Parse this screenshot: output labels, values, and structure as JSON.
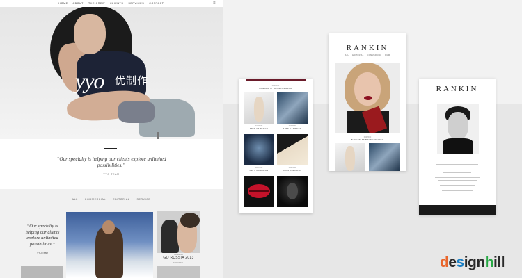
{
  "yyo": {
    "nav": [
      "HOME",
      "ABOUT",
      "THE CREW",
      "CLIENTS",
      "SERVICES",
      "CONTACT"
    ],
    "logo": "yyo",
    "logo_cn": "优制作",
    "quote": "“Our specialty is helping our clients explore unlimited possibilities.”",
    "quote_by": "YYO TEAM",
    "filters": [
      "ALL",
      "COMMERCIAL",
      "EDITORIAL",
      "SERVICE"
    ],
    "quote2": "“Our specialty is helping our clients explore unlimited possibilities.”",
    "quote2_by": "YYO Team",
    "item_small": "FASHION",
    "item_title": "GQ RUSSIA 2013",
    "item_sub": "EDITORIAL"
  },
  "rankin1": {
    "caption_small": "FASHION",
    "caption_title": "BUGGAM ST BRONCOS ARCO",
    "tiles": [
      {
        "small": "FASHION",
        "title": "ARTS CAMPAIGN"
      },
      {
        "small": "FASHION",
        "title": "ARTS CAMPAIGN"
      },
      {
        "small": "FASHION",
        "title": "ARTS CAMPAIGN"
      },
      {
        "small": "FASHION",
        "title": "ARTS CAMPAIGN"
      }
    ]
  },
  "rankin2": {
    "brand": "RANKIN",
    "menu": [
      "ALL",
      "EDITORIAL",
      "COMMERCIAL",
      "FILM"
    ],
    "caption_small": "FASHION",
    "caption_title": "BUGGAM ST BRONCOS ARCO"
  },
  "rankin3": {
    "brand": "RANKIN"
  },
  "brand": {
    "d": "d",
    "e": "e",
    "s": "s",
    "i": "i",
    "g": "g",
    "n": "n",
    "h": "h",
    "ill": "ill"
  }
}
